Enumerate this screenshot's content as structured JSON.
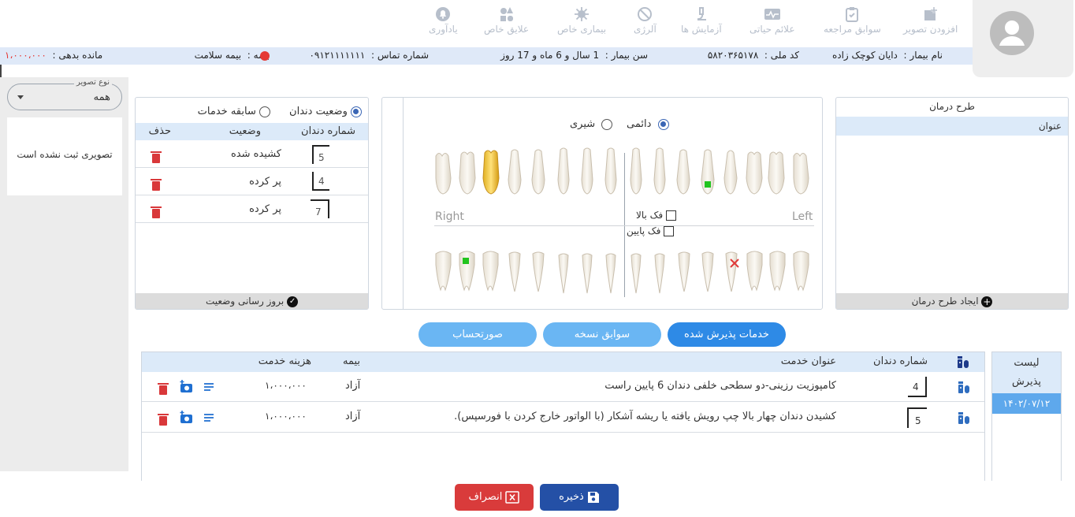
{
  "toolbar": {
    "items": [
      {
        "label": "افزودن تصویر",
        "icon": "add-photo-icon"
      },
      {
        "label": "سوابق مراجعه",
        "icon": "clipboard-icon"
      },
      {
        "label": "علائم حیاتی",
        "icon": "vitals-icon"
      },
      {
        "label": "آزمایش ها",
        "icon": "microscope-icon"
      },
      {
        "label": "آلرژی",
        "icon": "block-icon"
      },
      {
        "label": "بیماری خاص",
        "icon": "virus-icon"
      },
      {
        "label": "علایق خاص",
        "icon": "shapes-icon"
      },
      {
        "label": "یادآوری",
        "icon": "bell-icon"
      }
    ]
  },
  "patient": {
    "name_label": "نام بیمار :",
    "name": "دایان کوچک زاده",
    "national_id_label": "کد ملی :",
    "national_id": "۵۸۲۰۳۶۵۱۷۸",
    "age_label": "سن بیمار :",
    "age": "1 سال و 6 ماه و 17 روز",
    "phone_label": "شماره تماس :",
    "phone": "۰۹۱۲۱۱۱۱۱۱۱",
    "insurance_label": "بیمه :",
    "insurance": "بیمه سلامت",
    "debt_label": "مانده بدهی :",
    "debt": "۱،۰۰۰،۰۰۰",
    "colors": {
      "debt": "#e53935",
      "status_dot": "#e53935"
    }
  },
  "treatment_plan": {
    "title": "طرح درمان",
    "column": "عنوان",
    "create_label": "ایجاد طرح درمان"
  },
  "chart": {
    "permanent_label": "دائمی",
    "primary_label": "شیری",
    "selected": "permanent",
    "right_label": "Right",
    "left_label": "Left",
    "upper_jaw_label": "فک بالا",
    "lower_jaw_label": "فک پایین"
  },
  "tooth_status": {
    "tab_status": "وضعیت دندان",
    "tab_history": "سابقه خدمات",
    "columns": [
      "شماره دندان",
      "وضعیت",
      "حذف"
    ],
    "rows": [
      {
        "tooth": "5",
        "status": "کشیده شده"
      },
      {
        "tooth": "4",
        "status": "پر کرده"
      },
      {
        "tooth": "7",
        "status": "پر کرده"
      }
    ],
    "update_label": "بروز رسانی وضعیت"
  },
  "image_filter": {
    "label": "نوع تصویر",
    "value": "همه",
    "empty": "تصویری ثبت نشده است"
  },
  "tabs": {
    "accepted": "خدمات پذیرش شده",
    "prescriptions": "سوابق نسخه",
    "invoice": "صورتحساب"
  },
  "admissions": {
    "title_line1": "لیست",
    "title_line2": "پذیرش",
    "items": [
      "۱۴۰۲/۰۷/۱۲"
    ]
  },
  "services": {
    "columns": {
      "tooth": "شماره دندان",
      "title": "عنوان خدمت",
      "insurance": "بیمه",
      "cost": "هزینه خدمت"
    },
    "rows": [
      {
        "tooth": "4",
        "title": "کامپوزیت رزینی-دو سطحی خلفی دندان 6 پایین راست",
        "insurance": "آزاد",
        "cost": "۱،۰۰۰،۰۰۰"
      },
      {
        "tooth": "5",
        "title": "کشیدن دندان چهار بالا چپ رویش یافته یا ریشه آشکار (با الواتور خارج کردن با فورسپس).",
        "insurance": "آزاد",
        "cost": "۱،۰۰۰،۰۰۰"
      }
    ]
  },
  "footer": {
    "save_label": "ذخیره",
    "cancel_label": "انصراف"
  }
}
